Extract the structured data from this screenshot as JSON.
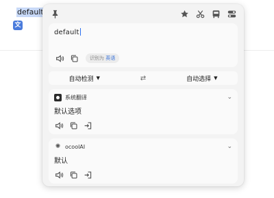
{
  "background": {
    "selected_text": "default",
    "trigger_icon": "translate-icon",
    "trigger_glyph": "文"
  },
  "popup": {
    "toolbar": {
      "left_icon": "pin-icon",
      "right_icons": [
        "star-icon",
        "scissors-icon",
        "app-icon",
        "toggle-icon"
      ]
    },
    "input": {
      "value": "default",
      "detected_label": "识别为",
      "detected_language": "英语",
      "actions": [
        "speaker-icon",
        "copy-icon"
      ]
    },
    "languages": {
      "source": "自动检测",
      "target": "自动选择",
      "swap_icon": "swap-icon"
    },
    "results": [
      {
        "service": "系统翻译",
        "logo": "system-translate-icon",
        "text": "默认选项",
        "actions": [
          "speaker-icon",
          "copy-icon",
          "insert-icon"
        ]
      },
      {
        "service": "ocoolAI",
        "logo": "ocoolai-icon",
        "text": "默认",
        "actions": [
          "speaker-icon",
          "copy-icon",
          "insert-icon"
        ]
      }
    ]
  },
  "colors": {
    "selection_highlight": "#c8d9f7",
    "accent_blue": "#3b73d9",
    "popup_bg": "#f3f3f3",
    "card_bg": "#fafafa"
  }
}
